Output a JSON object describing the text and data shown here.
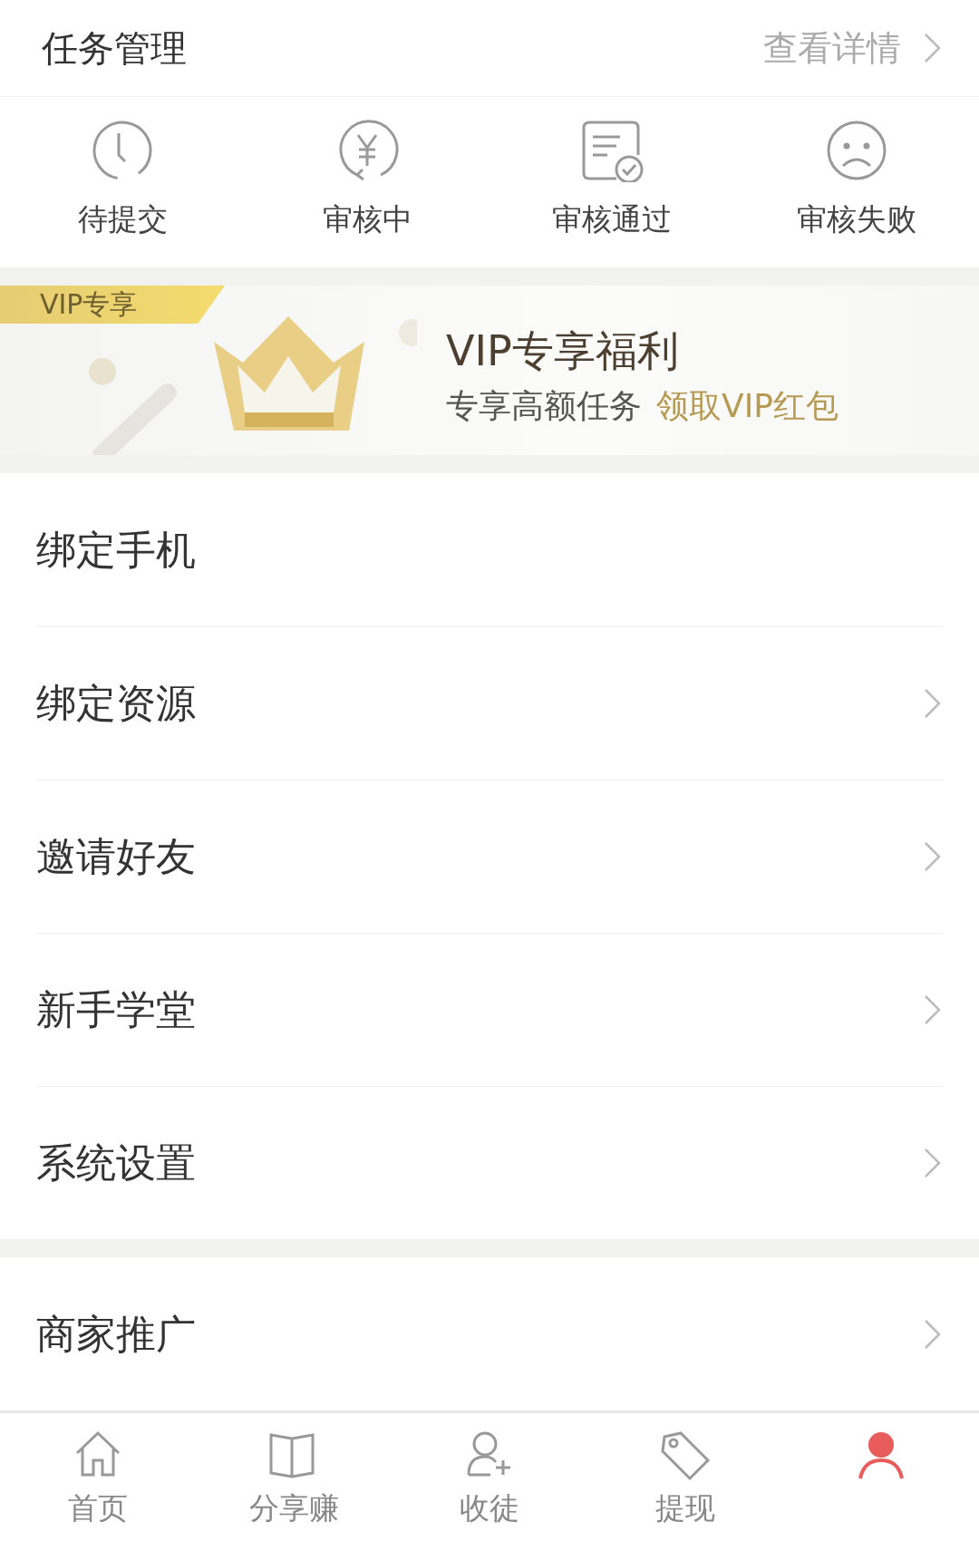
{
  "task_header": {
    "title": "任务管理",
    "link": "查看详情",
    "chevron": true
  },
  "task_status": [
    {
      "kind": "clock",
      "label": "待提交"
    },
    {
      "kind": "yuan",
      "label": "审核中"
    },
    {
      "kind": "doc-check",
      "label": "审核通过"
    },
    {
      "kind": "sad",
      "label": "审核失败"
    }
  ],
  "vip_banner": {
    "tag": "VIP专享",
    "title": "VIP专享福利",
    "subtitle": "专享高额任务",
    "highlight": "领取VIP红包"
  },
  "menu_groups": [
    [
      {
        "label": "绑定手机",
        "chevron": false
      },
      {
        "label": "绑定资源",
        "chevron": true
      },
      {
        "label": "邀请好友",
        "chevron": true
      },
      {
        "label": "新手学堂",
        "chevron": true
      },
      {
        "label": "系统设置",
        "chevron": true
      }
    ],
    [
      {
        "label": "商家推广",
        "chevron": true
      }
    ]
  ],
  "tab_bar": [
    {
      "kind": "home",
      "label": "首页",
      "selected": false
    },
    {
      "kind": "book",
      "label": "分享赚",
      "selected": false
    },
    {
      "kind": "user-plus",
      "label": "收徒",
      "selected": false
    },
    {
      "kind": "tag",
      "label": "提现",
      "selected": false
    },
    {
      "kind": "person",
      "selected": true
    }
  ]
}
